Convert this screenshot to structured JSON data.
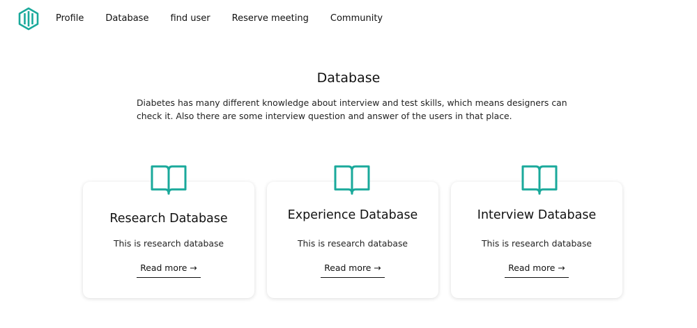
{
  "nav": {
    "links": [
      "Profile",
      "Database",
      "find user",
      "Reserve meeting",
      "Community"
    ]
  },
  "main": {
    "title": "Database",
    "intro": "Diabetes has many different knowledge about interview and test skills, which means designers can check it. Also there are some interview question and answer of the users in that place."
  },
  "cards": [
    {
      "title": "Research Database",
      "description": "This is research database",
      "link": "Read more",
      "arrow": "→"
    },
    {
      "title": "Experience Database",
      "description": "This is research database",
      "link": "Read more",
      "arrow": "→"
    },
    {
      "title": "Interview Database",
      "description": "This is research database",
      "link": "Read more",
      "arrow": "→"
    }
  ],
  "colors": {
    "accent": "#1aa99b"
  },
  "icons": {
    "logo": "logo-icon",
    "card": "book-open-icon"
  }
}
